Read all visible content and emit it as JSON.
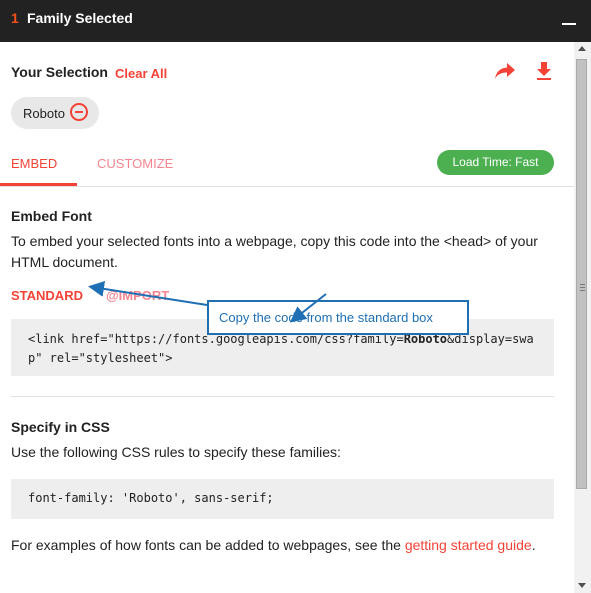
{
  "header": {
    "count": "1",
    "title": "Family Selected"
  },
  "selection": {
    "title": "Your Selection",
    "clear_all": "Clear All",
    "share_icon": "share-icon",
    "download_icon": "download-icon"
  },
  "chips": [
    {
      "label": "Roboto"
    }
  ],
  "tabs": [
    {
      "label": "EMBED",
      "active": true
    },
    {
      "label": "CUSTOMIZE",
      "active": false
    }
  ],
  "load_time": "Load Time: Fast",
  "embed": {
    "title": "Embed Font",
    "desc_line1": "To embed your selected fonts into a webpage, copy this code into the <head> of your",
    "desc_line2": "HTML document.",
    "sub_tabs": [
      {
        "label": "STANDARD",
        "active": true
      },
      {
        "label": "@IMPORT",
        "active": false
      }
    ],
    "code_line1_a": "<link href=\"https://fonts.googleapis.com/css?family=",
    "code_family": "Roboto",
    "code_line1_b": "&display=swa",
    "code_line2": "p\" rel=\"stylesheet\">"
  },
  "callout": "Copy the code from the standard box",
  "css": {
    "title": "Specify in CSS",
    "desc": "Use the following CSS rules to specify these families:",
    "code": "font-family: 'Roboto', sans-serif;"
  },
  "footer": {
    "text": "For examples of how fonts can be added to webpages, see the ",
    "link": "getting started guide",
    "end": "."
  },
  "colors": {
    "accent": "#f44336",
    "header_bg": "#222222",
    "badge": "#4caf50",
    "callout": "#1e6fb3"
  }
}
